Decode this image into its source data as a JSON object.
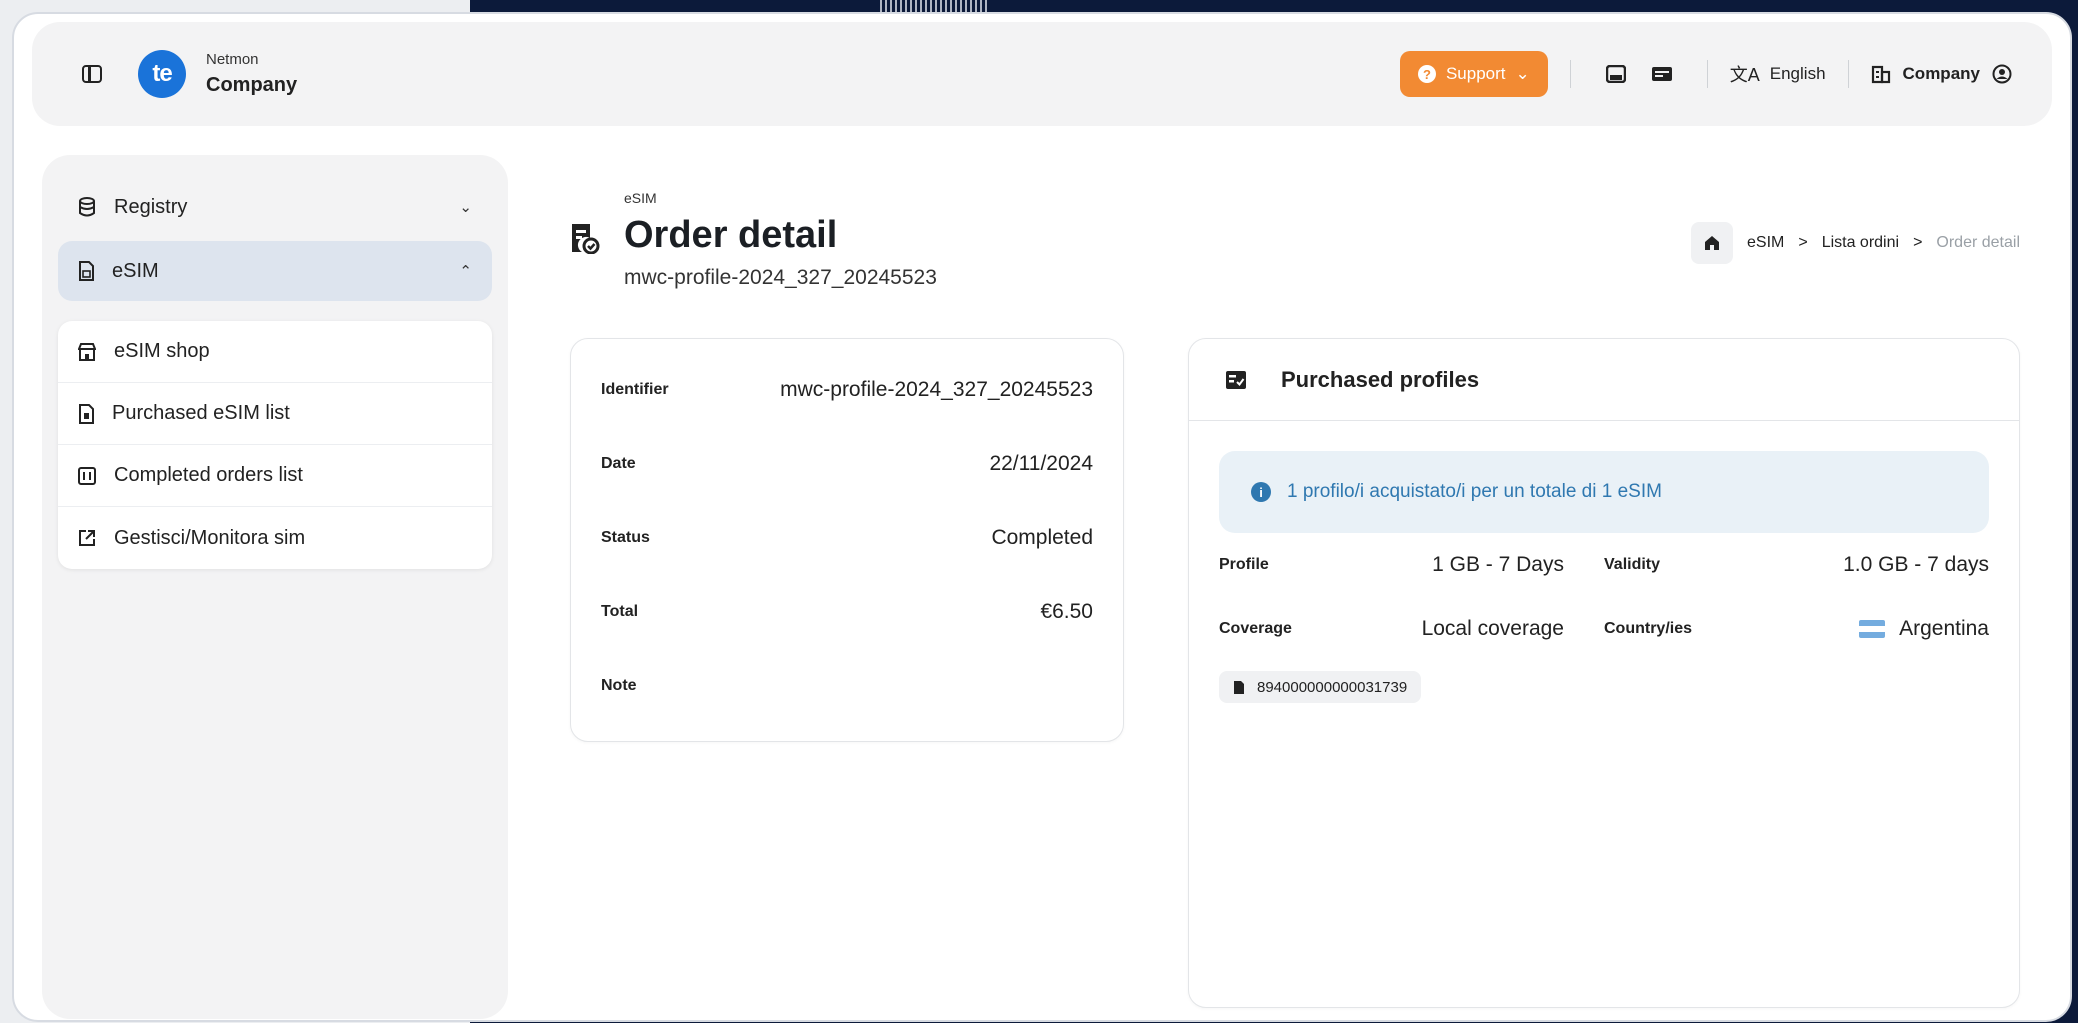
{
  "header": {
    "brand_sub": "Netmon",
    "brand_main": "Company",
    "logo_text": "te",
    "support_label": "Support",
    "language_label": "English",
    "company_label": "Company"
  },
  "sidebar": {
    "items": [
      {
        "label": "Registry",
        "icon": "database-icon",
        "expanded": false
      },
      {
        "label": "eSIM",
        "icon": "sim-card-icon",
        "expanded": true
      }
    ],
    "submenu": [
      {
        "label": "eSIM shop",
        "icon": "shop-icon"
      },
      {
        "label": "Purchased eSIM list",
        "icon": "sim-card-icon"
      },
      {
        "label": "Completed orders list",
        "icon": "list-icon"
      },
      {
        "label": "Gestisci/Monitora sim",
        "icon": "external-link-icon"
      }
    ]
  },
  "page": {
    "section": "eSIM",
    "title": "Order detail",
    "subtitle": "mwc-profile-2024_327_20245523"
  },
  "breadcrumb": {
    "items": [
      "eSIM",
      "Lista ordini"
    ],
    "current": "Order detail"
  },
  "order": {
    "rows": [
      {
        "label": "Identifier",
        "value": "mwc-profile-2024_327_20245523"
      },
      {
        "label": "Date",
        "value": "22/11/2024"
      },
      {
        "label": "Status",
        "value": "Completed"
      },
      {
        "label": "Total",
        "value": "€6.50"
      },
      {
        "label": "Note",
        "value": ""
      }
    ]
  },
  "profiles": {
    "title": "Purchased profiles",
    "info": "1 profilo/i acquistato/i per un totale di 1 eSIM",
    "profile_label": "Profile",
    "profile_value": "1 GB - 7 Days",
    "validity_label": "Validity",
    "validity_value": "1.0 GB - 7 days",
    "coverage_label": "Coverage",
    "coverage_value": "Local coverage",
    "country_label": "Country/ies",
    "country_value": "Argentina",
    "iccid": "894000000000031739"
  },
  "colors": {
    "accent": "#f28a33",
    "brand": "#1a73d9",
    "info": "#2f78b0",
    "active_bg": "#dde4ee"
  }
}
